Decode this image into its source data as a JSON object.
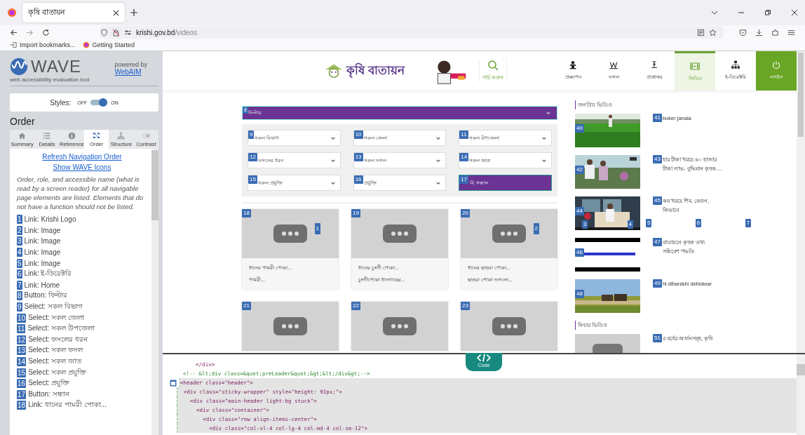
{
  "browser": {
    "tab_title": "কৃষি বাতায়ন",
    "url_host": "krishi.gov.bd",
    "url_path": "/videos",
    "bookmarks": [
      "Import bookmarks...",
      "Getting Started"
    ]
  },
  "wave": {
    "title": "WAVE",
    "tagline": "web accessibility evaluation tool",
    "powered_by": "powered by",
    "webaim_link": "WebAIM",
    "styles_label": "Styles:",
    "styles_off": "OFF",
    "styles_on": "ON",
    "styles_on_state": true,
    "panel_title": "Order",
    "tabs": [
      {
        "label": "Summary",
        "selected": false
      },
      {
        "label": "Details",
        "selected": false
      },
      {
        "label": "Reference",
        "selected": false
      },
      {
        "label": "Order",
        "selected": true
      },
      {
        "label": "Structure",
        "selected": false
      },
      {
        "label": "Contrast",
        "selected": false
      }
    ],
    "links": [
      "Refresh Navigation Order",
      "Show WAVE Icons"
    ],
    "description": "Order, role, and accessible name (what is read by a screen reader) for all navigable page elements are listed. Elements that do not have a function should not be listed.",
    "order_items": [
      {
        "number": "1",
        "text": "Link: Krishi Logo"
      },
      {
        "number": "2",
        "text": "Link: Image"
      },
      {
        "number": "3",
        "text": "Link: Image"
      },
      {
        "number": "4",
        "text": "Link: Image"
      },
      {
        "number": "5",
        "text": "Link: Image"
      },
      {
        "number": "6",
        "text": "Link: ই-ডিরেক্টরি"
      },
      {
        "number": "7",
        "text": "Link: Home"
      },
      {
        "number": "8",
        "text": "Button: ফিল্টার"
      },
      {
        "number": "9",
        "text": "Select: সকল বিভাগ"
      },
      {
        "number": "10",
        "text": "Select: সকল জেলা"
      },
      {
        "number": "11",
        "text": "Select: সকল উপজেলা"
      },
      {
        "number": "12",
        "text": "Select: ফসলের ধরন"
      },
      {
        "number": "13",
        "text": "Select: সকল ফসল"
      },
      {
        "number": "14",
        "text": "Select: সকল জাত"
      },
      {
        "number": "15",
        "text": "Select: সকল প্রযুক্তি"
      },
      {
        "number": "16",
        "text": "Select: প্রযুক্তি"
      },
      {
        "number": "17",
        "text": "Button: সন্ধান"
      },
      {
        "number": "18",
        "text": "Link: ধানের পামরী পোকা..."
      }
    ]
  },
  "site": {
    "logo": "কৃষি বাতায়ন",
    "search_label": "সার্চ করুন",
    "nav": [
      {
        "label": "প্রজ্ঞাপন",
        "selected": false
      },
      {
        "label": "ফসল",
        "selected": false
      },
      {
        "label": "প্রশ্নোত্তর",
        "selected": false
      },
      {
        "label": "ভিডিও",
        "selected": true
      },
      {
        "label": "ই-ডিরেক্টরি",
        "selected": false
      },
      {
        "label": "লগইন",
        "selected": false
      }
    ],
    "filter": {
      "badge": "8",
      "label": "ফিল্টার",
      "selects": [
        {
          "badge": "9",
          "label": "সকল বিভাগ"
        },
        {
          "badge": "10",
          "label": "সকল জেলা"
        },
        {
          "badge": "11",
          "label": "সকল উপজেলা"
        },
        {
          "badge": "12",
          "label": "ফসলের ধরন"
        },
        {
          "badge": "13",
          "label": "সকল ফসল"
        },
        {
          "badge": "14",
          "label": "সকল জাত"
        },
        {
          "badge": "15",
          "label": "সকল প্রযুক্তি"
        },
        {
          "badge": "16",
          "label": "প্রযুক্তি"
        }
      ],
      "search_button": {
        "badge": "17",
        "label": "সন্ধান"
      }
    },
    "videos": [
      {
        "badge": "18",
        "side_badge": "1",
        "line1": "ধানের পামরী পোকা...",
        "line2": "পামরী..."
      },
      {
        "badge": "19",
        "line1": "ধানের চুংগী পোকা...",
        "line2": "চুংগীপোকা ধানগাছের..."
      },
      {
        "badge": "20",
        "side_badge": "2",
        "line1": "ধানের ছাতরা পোকা...",
        "line2": "ছাতরা পোকা ফসলো..."
      },
      {
        "badge": "21"
      },
      {
        "badge": "22"
      },
      {
        "badge": "23"
      }
    ],
    "popular": {
      "title": "জনপ্রিয় ভিডিও",
      "items": [
        {
          "thumb_badge": "40",
          "badge": "41",
          "title": "boker janala"
        },
        {
          "thumb_badge": "42",
          "badge": "43",
          "title": "হার টাকা খরচে ৬০ হাজার টাকা লাভ- বুদ্ধিমান কৃষক-..."
        },
        {
          "thumb_badge": "44",
          "thumb_extra": [
            "3",
            "4"
          ],
          "badge": "45",
          "title": "কম খরচে শিম, বেগুন, কিভাবে",
          "extra_badges": [
            "5",
            "6",
            "7"
          ]
        },
        {
          "thumb_badge": "46",
          "badge": "47",
          "title": "বাতায়নে কৃষক তথ্য সন্নিবেশ পদ্ধতি"
        },
        {
          "thumb_badge": "48",
          "badge": "49",
          "title": "hi dibanishi debidwar"
        }
      ]
    },
    "featured": {
      "title": "ফিচার ভিডিও",
      "items": [
        {
          "badge": "51",
          "title": "র বর্ষের অর্জনসমূহ, কৃষি"
        }
      ]
    }
  },
  "code": {
    "toggle_label": "Code",
    "lines": [
      {
        "kind": "tag",
        "text": "      </div>",
        "highlighted": false
      },
      {
        "kind": "comment",
        "text": "  <!-- &lt;div class=&quot;preLoader&quot;&gt;&lt;/div&gt;-->",
        "highlighted": false
      },
      {
        "kind": "tag",
        "text": "<header class=\"header\">",
        "highlighted": true,
        "marker": true
      },
      {
        "kind": "tag",
        "text": "  <div class=\"sticky-wrapper\" style=\"height: 91px;\">",
        "highlighted": true
      },
      {
        "kind": "tag",
        "text": "    <div class=\"main-header light-bg stuck\">",
        "highlighted": true
      },
      {
        "kind": "tag",
        "text": "      <div class=\"container\">",
        "highlighted": true
      },
      {
        "kind": "tag",
        "text": "        <div class=\"row align-items-center\">",
        "highlighted": true
      },
      {
        "kind": "tag",
        "text": "          <div class=\"col-xl-4 col-lg-4 col-md-4 col-sm-12\">",
        "highlighted": true
      }
    ]
  }
}
